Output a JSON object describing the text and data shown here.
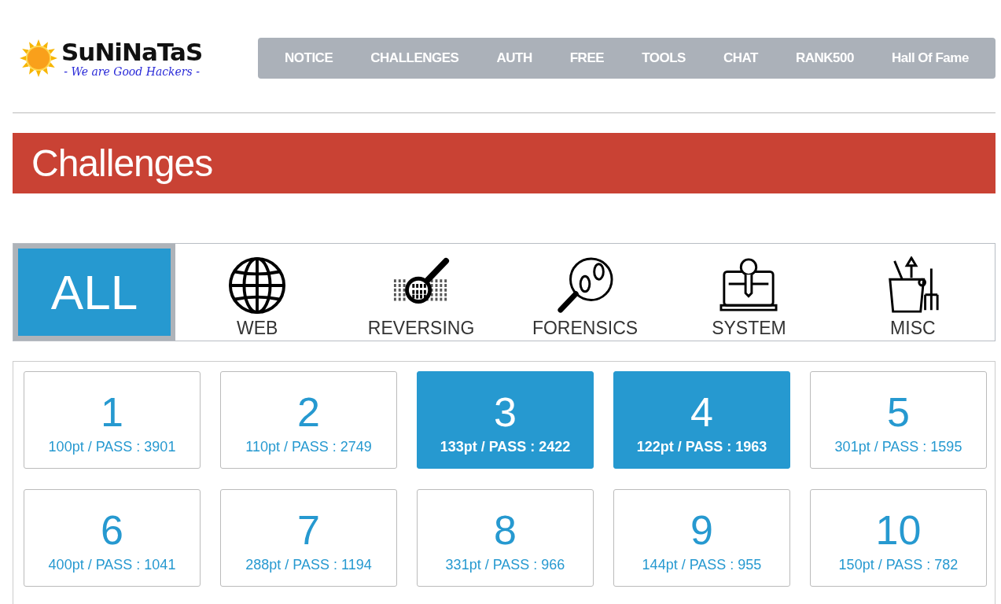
{
  "logo": {
    "name": "SuNiNaTaS",
    "tagline": "- We are Good Hackers -"
  },
  "nav": [
    "NOTICE",
    "CHALLENGES",
    "AUTH",
    "FREE",
    "TOOLS",
    "CHAT",
    "RANK500",
    "Hall Of Fame"
  ],
  "page_title": "Challenges",
  "categories": [
    {
      "kind": "all",
      "label": "ALL",
      "selected": true
    },
    {
      "kind": "web",
      "label": "WEB",
      "selected": false
    },
    {
      "kind": "reversing",
      "label": "REVERSING",
      "selected": false
    },
    {
      "kind": "forensics",
      "label": "FORENSICS",
      "selected": false
    },
    {
      "kind": "system",
      "label": "SYSTEM",
      "selected": false
    },
    {
      "kind": "misc",
      "label": "MISC",
      "selected": false
    }
  ],
  "challenges": [
    {
      "number": "1",
      "info": "100pt / PASS : 3901",
      "highlighted": false
    },
    {
      "number": "2",
      "info": "110pt / PASS : 2749",
      "highlighted": false
    },
    {
      "number": "3",
      "info": "133pt / PASS : 2422",
      "highlighted": true
    },
    {
      "number": "4",
      "info": "122pt / PASS : 1963",
      "highlighted": true
    },
    {
      "number": "5",
      "info": "301pt / PASS : 1595",
      "highlighted": false
    },
    {
      "number": "6",
      "info": "400pt / PASS : 1041",
      "highlighted": false
    },
    {
      "number": "7",
      "info": "288pt / PASS : 1194",
      "highlighted": false
    },
    {
      "number": "8",
      "info": "331pt / PASS : 966",
      "highlighted": false
    },
    {
      "number": "9",
      "info": "144pt / PASS : 955",
      "highlighted": false
    },
    {
      "number": "10",
      "info": "150pt / PASS : 782",
      "highlighted": false
    }
  ]
}
